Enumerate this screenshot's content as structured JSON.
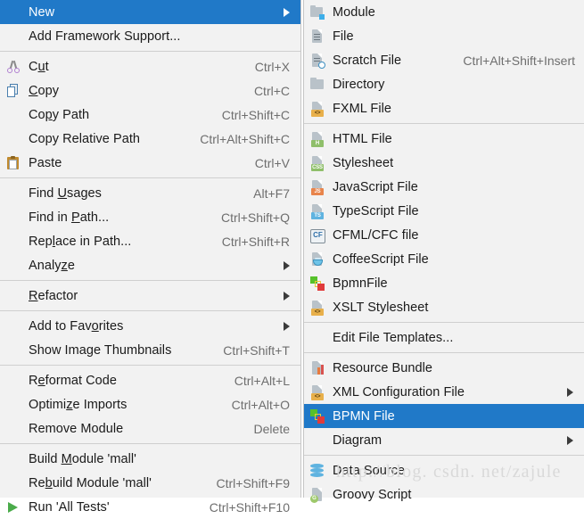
{
  "theme": {
    "menu_background": "#f2f2f2",
    "selection_background": "#2079c8",
    "selection_text": "#ffffff",
    "text": "#1a1a1a",
    "shortcut_text": "#6e6e6e",
    "border": "#c6c6c6",
    "separator": "#cfcfcf"
  },
  "context_menu": {
    "name": "project-context-menu",
    "groups": [
      {
        "items": [
          {
            "label": "New",
            "shortcut": "",
            "icon": "",
            "submenu": true,
            "selected": true
          },
          {
            "label": "Add Framework Support...",
            "shortcut": "",
            "icon": "",
            "submenu": false,
            "selected": false
          }
        ]
      },
      {
        "items": [
          {
            "label": "Cut",
            "shortcut": "Ctrl+X",
            "icon": "scissors-icon",
            "submenu": false,
            "selected": false
          },
          {
            "label": "Copy",
            "shortcut": "Ctrl+C",
            "icon": "copy-icon",
            "submenu": false,
            "selected": false
          },
          {
            "label": "Copy Path",
            "shortcut": "Ctrl+Shift+C",
            "icon": "",
            "submenu": false,
            "selected": false
          },
          {
            "label": "Copy Relative Path",
            "shortcut": "Ctrl+Alt+Shift+C",
            "icon": "",
            "submenu": false,
            "selected": false
          },
          {
            "label": "Paste",
            "shortcut": "Ctrl+V",
            "icon": "paste-icon",
            "submenu": false,
            "selected": false
          }
        ]
      },
      {
        "items": [
          {
            "label": "Find Usages",
            "shortcut": "Alt+F7",
            "icon": "",
            "submenu": false,
            "selected": false
          },
          {
            "label": "Find in Path...",
            "shortcut": "Ctrl+Shift+Q",
            "icon": "",
            "submenu": false,
            "selected": false
          },
          {
            "label": "Replace in Path...",
            "shortcut": "Ctrl+Shift+R",
            "icon": "",
            "submenu": false,
            "selected": false
          },
          {
            "label": "Analyze",
            "shortcut": "",
            "icon": "",
            "submenu": true,
            "selected": false
          }
        ]
      },
      {
        "items": [
          {
            "label": "Refactor",
            "shortcut": "",
            "icon": "",
            "submenu": true,
            "selected": false
          }
        ]
      },
      {
        "items": [
          {
            "label": "Add to Favorites",
            "shortcut": "",
            "icon": "",
            "submenu": true,
            "selected": false
          },
          {
            "label": "Show Image Thumbnails",
            "shortcut": "Ctrl+Shift+T",
            "icon": "",
            "submenu": false,
            "selected": false
          }
        ]
      },
      {
        "items": [
          {
            "label": "Reformat Code",
            "shortcut": "Ctrl+Alt+L",
            "icon": "",
            "submenu": false,
            "selected": false
          },
          {
            "label": "Optimize Imports",
            "shortcut": "Ctrl+Alt+O",
            "icon": "",
            "submenu": false,
            "selected": false
          },
          {
            "label": "Remove Module",
            "shortcut": "Delete",
            "icon": "",
            "submenu": false,
            "selected": false
          }
        ]
      },
      {
        "items": [
          {
            "label": "Build Module 'mall'",
            "shortcut": "",
            "icon": "",
            "submenu": false,
            "selected": false
          },
          {
            "label": "Rebuild Module 'mall'",
            "shortcut": "Ctrl+Shift+F9",
            "icon": "",
            "submenu": false,
            "selected": false
          },
          {
            "label": "Run 'All Tests'",
            "shortcut": "Ctrl+Shift+F10",
            "icon": "run-icon",
            "submenu": false,
            "selected": false
          }
        ]
      }
    ]
  },
  "new_submenu": {
    "name": "new-submenu",
    "groups": [
      {
        "items": [
          {
            "label": "Module",
            "shortcut": "",
            "icon": "module-icon",
            "submenu": false,
            "selected": false
          },
          {
            "label": "File",
            "shortcut": "",
            "icon": "file-icon",
            "submenu": false,
            "selected": false
          },
          {
            "label": "Scratch File",
            "shortcut": "Ctrl+Alt+Shift+Insert",
            "icon": "scratch-file-icon",
            "submenu": false,
            "selected": false
          },
          {
            "label": "Directory",
            "shortcut": "",
            "icon": "directory-icon",
            "submenu": false,
            "selected": false
          },
          {
            "label": "FXML File",
            "shortcut": "",
            "icon": "fxml-file-icon",
            "submenu": false,
            "selected": false
          }
        ]
      },
      {
        "items": [
          {
            "label": "HTML File",
            "shortcut": "",
            "icon": "html-file-icon",
            "submenu": false,
            "selected": false
          },
          {
            "label": "Stylesheet",
            "shortcut": "",
            "icon": "css-file-icon",
            "submenu": false,
            "selected": false
          },
          {
            "label": "JavaScript File",
            "shortcut": "",
            "icon": "js-file-icon",
            "submenu": false,
            "selected": false
          },
          {
            "label": "TypeScript File",
            "shortcut": "",
            "icon": "ts-file-icon",
            "submenu": false,
            "selected": false
          },
          {
            "label": "CFML/CFC file",
            "shortcut": "",
            "icon": "cfml-file-icon",
            "submenu": false,
            "selected": false
          },
          {
            "label": "CoffeeScript File",
            "shortcut": "",
            "icon": "coffeescript-file-icon",
            "submenu": false,
            "selected": false
          },
          {
            "label": "BpmnFile",
            "shortcut": "",
            "icon": "bpmn-icon",
            "submenu": false,
            "selected": false
          },
          {
            "label": "XSLT Stylesheet",
            "shortcut": "",
            "icon": "xslt-file-icon",
            "submenu": false,
            "selected": false
          }
        ]
      },
      {
        "items": [
          {
            "label": "Edit File Templates...",
            "shortcut": "",
            "icon": "",
            "submenu": false,
            "selected": false
          }
        ]
      },
      {
        "items": [
          {
            "label": "Resource Bundle",
            "shortcut": "",
            "icon": "resource-bundle-icon",
            "submenu": false,
            "selected": false
          },
          {
            "label": "XML Configuration File",
            "shortcut": "",
            "icon": "xml-config-file-icon",
            "submenu": true,
            "selected": false
          },
          {
            "label": "BPMN File",
            "shortcut": "",
            "icon": "bpmn-icon",
            "submenu": false,
            "selected": true
          },
          {
            "label": "Diagram",
            "shortcut": "",
            "icon": "",
            "submenu": true,
            "selected": false
          }
        ]
      },
      {
        "items": [
          {
            "label": "Data Source",
            "shortcut": "",
            "icon": "data-source-icon",
            "submenu": false,
            "selected": false
          },
          {
            "label": "Groovy Script",
            "shortcut": "",
            "icon": "groovy-script-icon",
            "submenu": false,
            "selected": false
          }
        ]
      }
    ]
  },
  "watermark": {
    "text": "http://blog. csdn. net/zajule"
  }
}
